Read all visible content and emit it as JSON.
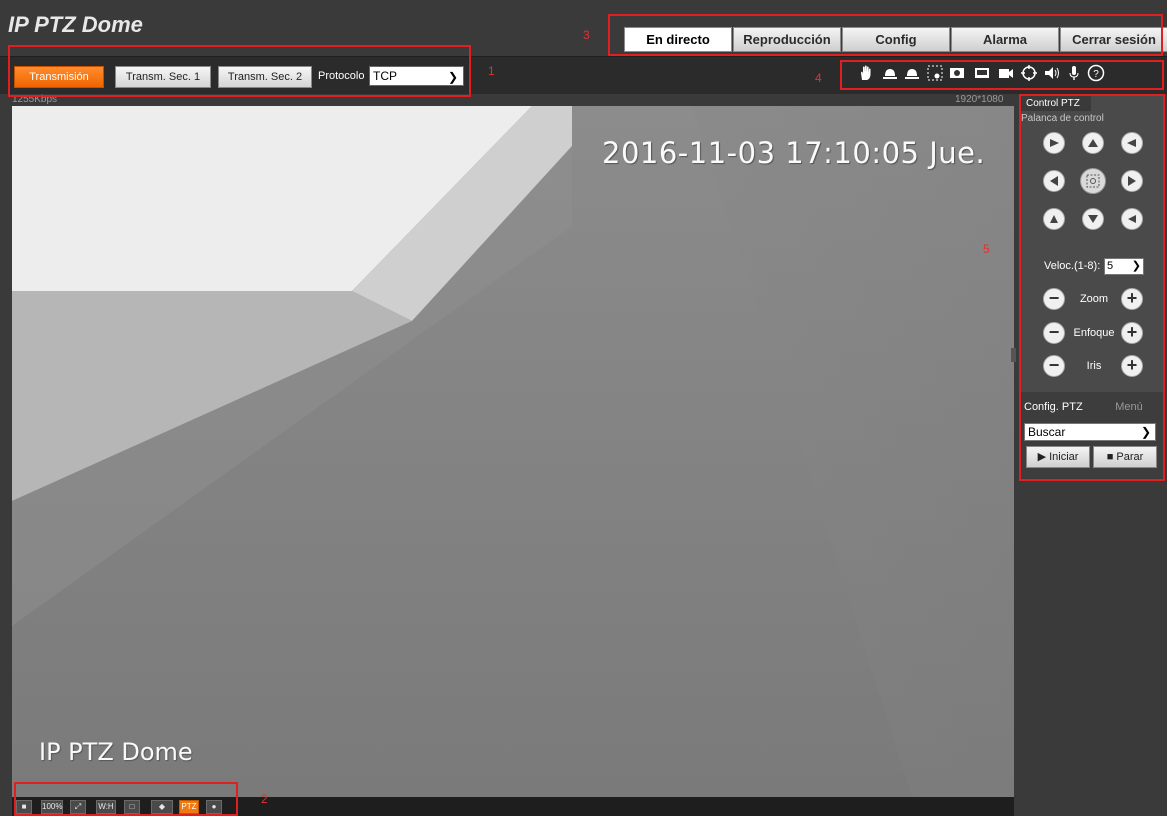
{
  "header": {
    "title": "IP PTZ Dome",
    "nav": [
      "En directo",
      "Reproducción",
      "Config",
      "Alarma",
      "Cerrar sesión"
    ],
    "active_nav": "En directo"
  },
  "toolbar": {
    "streams": [
      "Transmisión",
      "Transm. Sec. 1",
      "Transm. Sec. 2"
    ],
    "active_stream": "Transmisión",
    "protocol_label": "Protocolo",
    "protocol_value": "TCP"
  },
  "toolbar_icons": [
    "hand-icon",
    "alarm-out-icon",
    "alarm-in-icon",
    "region-focus-icon",
    "snapshot-icon",
    "triple-snapshot-icon",
    "record-icon",
    "zoom-icon",
    "audio-icon",
    "mic-icon",
    "help-icon"
  ],
  "video": {
    "bitrate": "1255Kbps",
    "resolution": "1920*1080",
    "osd_time": "2016-11-03 17:10:05 Jue.",
    "osd_name": "IP PTZ Dome"
  },
  "bottom_icons": [
    "original-size",
    "100%",
    "fullscreen",
    "W:H",
    "Zoom",
    "Fisheye",
    "PTZ",
    "Pin"
  ],
  "ptz": {
    "tab": "Control PTZ",
    "subtab": "Palanca de control",
    "speed_label": "Veloc.(1-8):",
    "speed_value": "5",
    "zoom_label": "Zoom",
    "focus_label": "Enfoque",
    "iris_label": "Iris",
    "config_tab": "Config. PTZ",
    "menu_tab": "Menú",
    "mode_value": "Buscar",
    "start_label": "Iniciar",
    "stop_label": "Parar"
  },
  "annotations": [
    "1",
    "2",
    "3",
    "4",
    "5"
  ],
  "colors": {
    "accent": "#f06400",
    "annotation": "#e02020",
    "background": "#3a3a3a"
  }
}
